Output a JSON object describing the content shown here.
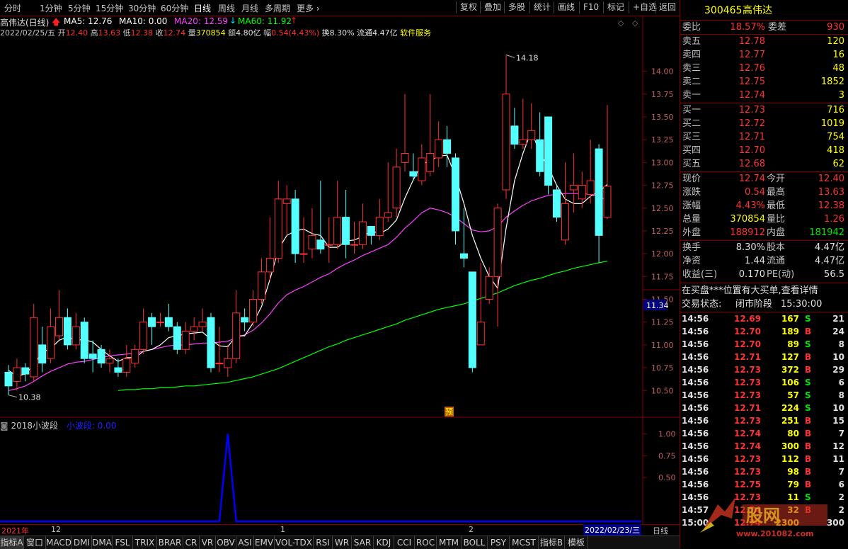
{
  "toolbar": {
    "left": [
      "分时",
      "1分钟",
      "5分钟",
      "15分钟",
      "30分钟",
      "60分钟",
      "日线",
      "周线",
      "月线",
      "多周期",
      "更多"
    ],
    "active": "日线",
    "right": [
      "复权",
      "叠加",
      "多股",
      "统计",
      "画线",
      "F10",
      "标记",
      "+自选",
      "返回"
    ]
  },
  "chart_title": "高伟达(日线)",
  "ma": [
    {
      "label": "MA5: 12.76",
      "color": "#ffffff"
    },
    {
      "label": "MA10: 0.00",
      "color": "#ffffff"
    },
    {
      "label": "MA20: 12.59",
      "color": "#ff40ff"
    },
    {
      "label": "MA60: 11.92",
      "color": "#00ff00"
    }
  ],
  "info": {
    "date": "2022/02/25/五",
    "open_label": "开",
    "open": "12.40",
    "high_label": "高",
    "high": "13.63",
    "low_label": "低",
    "low": "12.38",
    "close_label": "收",
    "close": "12.74",
    "vol_label": "量",
    "vol": "370854",
    "amt_label": "额",
    "amt": "4.80亿",
    "range_label": "幅",
    "range": "0.54(4.43%)",
    "turn": "换8.30%",
    "float": "流通4.47亿",
    "sector": "软件服务"
  },
  "price_axis": [
    "14.00",
    "13.75",
    "13.50",
    "13.25",
    "13.00",
    "12.75",
    "12.50",
    "12.25",
    "12.00",
    "11.75",
    "11.50",
    "11.25",
    "11.00",
    "10.75",
    "10.50"
  ],
  "price_tag": "11.34",
  "high_mark": "14.18",
  "low_mark": "10.38",
  "yu_badge": "预",
  "indicator": {
    "name": "2018小波段",
    "line_label": "小波段: 0.00",
    "axis": [
      "1.00",
      "0.75",
      "0.50"
    ]
  },
  "xaxis": {
    "year": "2021年",
    "m12": "12",
    "m1": "1",
    "m2": "2",
    "last_date": "2022/02/23/三",
    "period": "日线"
  },
  "tabs": [
    "指标A",
    "窗口",
    "MACD",
    "DMI",
    "DMA",
    "FSL",
    "TRIX",
    "BRAR",
    "CR",
    "VR",
    "OBV",
    "ASI",
    "EMV",
    "VOL-TDX",
    "RSI",
    "WR",
    "SAR",
    "KDJ",
    "CCI",
    "ROC",
    "MTM",
    "BOLL",
    "PSY",
    "MCST",
    "指标B",
    "模板"
  ],
  "panel": {
    "code": "300465",
    "name": "高伟达",
    "weibi_label": "委比",
    "weibi": "18.57%",
    "weicha_label": "委差",
    "weicha": "930",
    "asks": [
      {
        "label": "卖五",
        "price": "12.78",
        "vol": "120"
      },
      {
        "label": "卖四",
        "price": "12.77",
        "vol": "16"
      },
      {
        "label": "卖三",
        "price": "12.76",
        "vol": "48"
      },
      {
        "label": "卖二",
        "price": "12.75",
        "vol": "1852"
      },
      {
        "label": "卖一",
        "price": "12.74",
        "vol": "3"
      }
    ],
    "bids": [
      {
        "label": "买一",
        "price": "12.73",
        "vol": "716"
      },
      {
        "label": "买二",
        "price": "12.72",
        "vol": "1019"
      },
      {
        "label": "买三",
        "price": "12.71",
        "vol": "754"
      },
      {
        "label": "买四",
        "price": "12.70",
        "vol": "418"
      },
      {
        "label": "买五",
        "price": "12.68",
        "vol": "62"
      }
    ],
    "stats": [
      {
        "l1": "现价",
        "v1": "12.74",
        "c1": "red",
        "l2": "今开",
        "v2": "12.40",
        "c2": "red"
      },
      {
        "l1": "涨跌",
        "v1": "0.54",
        "c1": "red",
        "l2": "最高",
        "v2": "13.63",
        "c2": "red"
      },
      {
        "l1": "涨幅",
        "v1": "4.43%",
        "c1": "red",
        "l2": "最低",
        "v2": "12.38",
        "c2": "red"
      },
      {
        "l1": "总量",
        "v1": "370854",
        "c1": "yellow",
        "l2": "量比",
        "v2": "1.26",
        "c2": "red"
      },
      {
        "l1": "外盘",
        "v1": "188912",
        "c1": "red",
        "l2": "内盘",
        "v2": "181942",
        "c2": "green"
      }
    ],
    "stats2": [
      {
        "l1": "换手",
        "v1": "8.30%",
        "l2": "股本",
        "v2": "4.47亿"
      },
      {
        "l1": "净资",
        "v1": "1.44",
        "l2": "流通",
        "v2": "4.47亿"
      },
      {
        "l1": "收益(三)",
        "v1": "0.170",
        "l2": "PE(动)",
        "v2": "56.5"
      }
    ],
    "notice": "在买盘***位置有大买单,查看详情",
    "status_label": "交易状态:",
    "status": "闭市阶段",
    "status_time": "15:30:00",
    "trades": [
      {
        "t": "14:56",
        "p": "12.69",
        "v": "167",
        "bs": "S",
        "n": "21"
      },
      {
        "t": "14:56",
        "p": "12.70",
        "v": "189",
        "bs": "B",
        "n": "24"
      },
      {
        "t": "14:56",
        "p": "12.70",
        "v": "89",
        "bs": "S",
        "n": "8"
      },
      {
        "t": "14:56",
        "p": "12.71",
        "v": "127",
        "bs": "B",
        "n": "10"
      },
      {
        "t": "14:56",
        "p": "12.73",
        "v": "372",
        "bs": "B",
        "n": "29"
      },
      {
        "t": "14:56",
        "p": "12.73",
        "v": "106",
        "bs": "S",
        "n": "6"
      },
      {
        "t": "14:56",
        "p": "12.73",
        "v": "57",
        "bs": "S",
        "n": "8"
      },
      {
        "t": "14:56",
        "p": "12.71",
        "v": "224",
        "bs": "S",
        "n": "10"
      },
      {
        "t": "14:56",
        "p": "12.73",
        "v": "251",
        "bs": "B",
        "n": "15"
      },
      {
        "t": "14:56",
        "p": "12.74",
        "v": "80",
        "bs": "B",
        "n": "7"
      },
      {
        "t": "14:56",
        "p": "12.74",
        "v": "300",
        "bs": "B",
        "n": "12"
      },
      {
        "t": "14:56",
        "p": "12.73",
        "v": "112",
        "bs": "B",
        "n": "11"
      },
      {
        "t": "14:56",
        "p": "12.73",
        "v": "98",
        "bs": "B",
        "n": "7"
      },
      {
        "t": "14:56",
        "p": "12.75",
        "v": "79",
        "bs": "B",
        "n": "6"
      },
      {
        "t": "14:56",
        "p": "12.73",
        "v": "11",
        "bs": "S",
        "n": "2"
      },
      {
        "t": "14:57",
        "p": "12.74",
        "v": "32",
        "bs": "B",
        "n": "2"
      },
      {
        "t": "15:00",
        "p": "12.74",
        "v": "2300",
        "bs": "",
        "n": "300"
      }
    ]
  },
  "watermark": "www.201082.com",
  "colors": {
    "up": "#ff3232",
    "down": "#54ffff",
    "ma5": "#ffffff",
    "ma20": "#ff40ff",
    "ma60": "#00ff00",
    "wave": "#0000ff",
    "frame": "#800000"
  },
  "chart_data": {
    "type": "candlestick",
    "title": "高伟达(日线)",
    "ylim": [
      10.3,
      14.3
    ],
    "candles": [
      [
        10.7,
        10.55,
        10.78,
        10.45
      ],
      [
        10.6,
        10.75,
        10.85,
        10.5
      ],
      [
        10.75,
        10.68,
        10.8,
        10.6
      ],
      [
        10.65,
        11.3,
        11.45,
        10.6
      ],
      [
        11.0,
        10.8,
        11.2,
        10.7
      ],
      [
        10.85,
        11.2,
        11.4,
        10.8
      ],
      [
        11.1,
        11.3,
        11.6,
        11.05
      ],
      [
        11.3,
        11.0,
        11.4,
        10.95
      ],
      [
        11.0,
        11.2,
        11.35,
        10.95
      ],
      [
        11.25,
        10.85,
        11.3,
        10.8
      ],
      [
        10.9,
        10.85,
        11.05,
        10.7
      ],
      [
        10.95,
        10.8,
        11.0,
        10.75
      ],
      [
        10.8,
        10.85,
        10.95,
        10.7
      ],
      [
        10.75,
        10.7,
        10.85,
        10.65
      ],
      [
        10.7,
        10.85,
        11.0,
        10.65
      ],
      [
        10.8,
        10.95,
        11.0,
        10.75
      ],
      [
        10.95,
        11.25,
        11.4,
        10.9
      ],
      [
        11.3,
        11.2,
        11.35,
        11.0
      ],
      [
        11.25,
        11.25,
        11.35,
        11.2
      ],
      [
        11.3,
        11.2,
        11.45,
        11.15
      ],
      [
        11.2,
        10.95,
        11.25,
        10.9
      ],
      [
        10.95,
        11.15,
        11.25,
        10.9
      ],
      [
        11.15,
        11.2,
        11.3,
        11.05
      ],
      [
        11.2,
        11.25,
        11.4,
        11.15
      ],
      [
        11.3,
        10.75,
        11.35,
        10.7
      ],
      [
        10.8,
        10.8,
        11.2,
        10.7
      ],
      [
        10.75,
        10.85,
        11.0,
        10.65
      ],
      [
        10.85,
        11.35,
        11.6,
        10.8
      ],
      [
        11.3,
        11.25,
        11.4,
        11.15
      ],
      [
        11.25,
        11.5,
        11.6,
        11.2
      ],
      [
        11.5,
        11.8,
        11.95,
        11.45
      ],
      [
        11.8,
        11.95,
        12.4,
        11.7
      ],
      [
        11.95,
        12.6,
        12.8,
        11.9
      ],
      [
        12.55,
        12.6,
        12.75,
        12.2
      ],
      [
        12.6,
        12.0,
        12.7,
        11.9
      ],
      [
        12.0,
        12.0,
        12.4,
        11.9
      ],
      [
        12.05,
        12.2,
        12.5,
        11.95
      ],
      [
        12.15,
        12.05,
        12.8,
        12.0
      ],
      [
        12.1,
        12.1,
        12.4,
        11.9
      ],
      [
        12.1,
        12.4,
        12.8,
        12.05
      ],
      [
        12.4,
        12.1,
        12.7,
        11.95
      ],
      [
        12.1,
        12.1,
        12.35,
        12.0
      ],
      [
        12.1,
        12.35,
        12.55,
        12.05
      ],
      [
        12.3,
        12.2,
        12.3,
        12.1
      ],
      [
        12.2,
        12.4,
        12.6,
        12.15
      ],
      [
        12.4,
        12.45,
        13.0,
        12.35
      ],
      [
        12.5,
        12.95,
        13.15,
        12.4
      ],
      [
        13.0,
        13.1,
        13.75,
        12.9
      ],
      [
        12.9,
        12.85,
        13.1,
        12.8
      ],
      [
        12.8,
        13.05,
        13.2,
        12.75
      ],
      [
        12.9,
        13.1,
        13.75,
        12.85
      ],
      [
        13.05,
        13.25,
        13.45,
        12.95
      ],
      [
        13.25,
        13.1,
        13.4,
        12.95
      ],
      [
        13.05,
        12.25,
        13.1,
        12.1
      ],
      [
        12.0,
        11.95,
        12.5,
        11.85
      ],
      [
        11.8,
        10.75,
        11.8,
        10.7
      ],
      [
        11.0,
        11.25,
        11.9,
        11.0
      ],
      [
        11.5,
        11.75,
        11.85,
        11.45
      ],
      [
        11.75,
        12.5,
        12.55,
        11.2
      ],
      [
        12.7,
        13.75,
        14.18,
        12.6
      ],
      [
        13.4,
        13.2,
        13.6,
        13.15
      ],
      [
        13.2,
        13.25,
        13.7,
        13.15
      ],
      [
        13.25,
        13.35,
        13.65,
        13.15
      ],
      [
        13.25,
        12.9,
        13.55,
        12.85
      ],
      [
        13.5,
        12.75,
        13.45,
        12.65
      ],
      [
        12.7,
        12.4,
        12.75,
        12.35
      ],
      [
        12.15,
        12.55,
        13.0,
        12.1
      ],
      [
        12.7,
        12.75,
        13.1,
        12.45
      ],
      [
        12.6,
        12.75,
        12.9,
        12.5
      ],
      [
        12.65,
        12.8,
        13.25,
        12.55
      ],
      [
        13.15,
        12.2,
        13.2,
        11.9
      ],
      [
        12.4,
        12.74,
        13.63,
        12.38
      ]
    ],
    "ma5": [
      10.72,
      10.66,
      10.68,
      10.78,
      10.92,
      10.96,
      11.05,
      11.09,
      11.05,
      11.06,
      11.03,
      10.95,
      10.88,
      10.82,
      10.86,
      10.86,
      10.93,
      10.95,
      11.0,
      11.08,
      11.1,
      11.12,
      11.13,
      11.14,
      11.06,
      10.99,
      10.98,
      11.1,
      11.1,
      11.24,
      11.42,
      11.72,
      12.05,
      12.2,
      12.25,
      12.27,
      12.22,
      12.2,
      12.07,
      12.07,
      12.14,
      12.15,
      12.19,
      12.25,
      12.22,
      12.27,
      12.37,
      12.61,
      12.81,
      12.98,
      13.02,
      13.07,
      13.08,
      12.85,
      12.55,
      12.2,
      11.95,
      11.75,
      11.62,
      12.28,
      12.8,
      13.1,
      13.35,
      13.1,
      12.95,
      12.75,
      12.6,
      12.55,
      12.55,
      12.63,
      12.68,
      12.76
    ],
    "ma20": [
      10.5,
      10.52,
      10.55,
      10.6,
      10.66,
      10.71,
      10.75,
      10.79,
      10.81,
      10.82,
      10.84,
      10.86,
      10.88,
      10.89,
      10.9,
      10.91,
      10.93,
      10.95,
      10.97,
      10.99,
      11.0,
      11.0,
      11.01,
      11.02,
      11.02,
      11.03,
      11.04,
      11.08,
      11.11,
      11.16,
      11.24,
      11.34,
      11.46,
      11.55,
      11.6,
      11.64,
      11.69,
      11.74,
      11.78,
      11.84,
      11.89,
      11.93,
      11.98,
      12.02,
      12.06,
      12.1,
      12.18,
      12.28,
      12.36,
      12.45,
      12.5,
      12.48,
      12.45,
      12.4,
      12.33,
      12.26,
      12.24,
      12.25,
      12.3,
      12.4,
      12.47,
      12.53,
      12.58,
      12.61,
      12.64,
      12.65,
      12.66,
      12.66,
      12.66,
      12.65,
      12.62,
      12.59
    ],
    "ma60": [
      null,
      null,
      null,
      null,
      null,
      null,
      null,
      null,
      null,
      null,
      null,
      null,
      null,
      10.5,
      10.51,
      10.51,
      10.52,
      10.52,
      10.53,
      10.53,
      10.54,
      10.55,
      10.55,
      10.56,
      10.57,
      10.58,
      10.59,
      10.61,
      10.63,
      10.65,
      10.68,
      10.71,
      10.74,
      10.78,
      10.82,
      10.86,
      10.9,
      10.94,
      10.98,
      11.01,
      11.05,
      11.08,
      11.11,
      11.14,
      11.17,
      11.2,
      11.23,
      11.27,
      11.3,
      11.33,
      11.36,
      11.39,
      11.41,
      11.43,
      11.45,
      11.48,
      11.51,
      11.54,
      11.57,
      11.61,
      11.65,
      11.68,
      11.71,
      11.73,
      11.76,
      11.79,
      11.81,
      11.84,
      11.86,
      11.88,
      11.9,
      11.92
    ],
    "wave_signal_index": 26,
    "wave_ylim": [
      0,
      1.1
    ]
  }
}
